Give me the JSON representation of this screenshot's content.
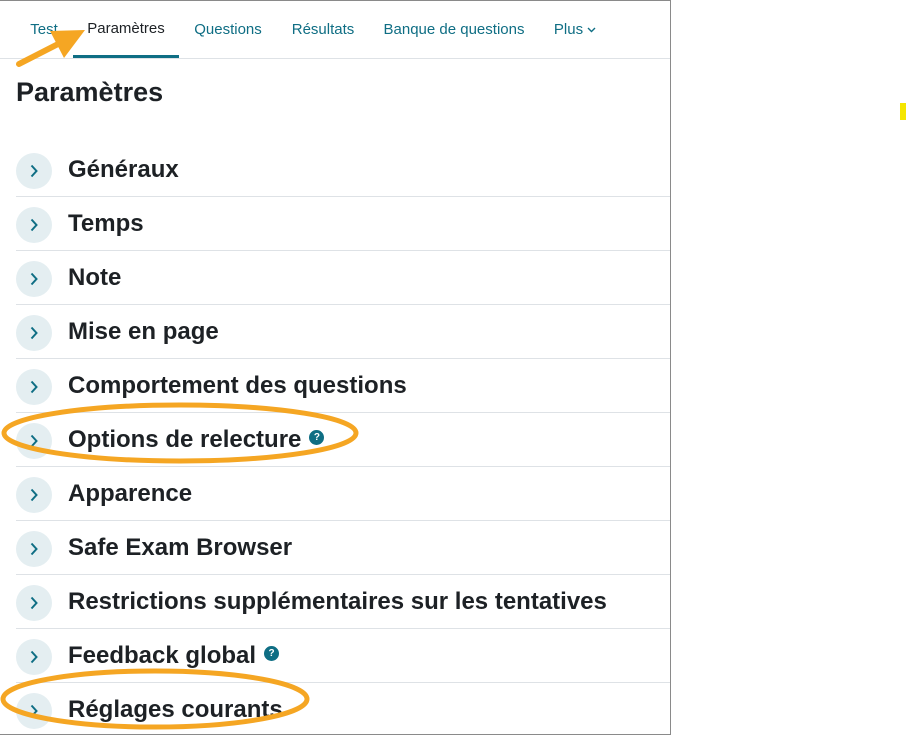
{
  "tabs": [
    {
      "label": "Test",
      "active": false
    },
    {
      "label": "Paramètres",
      "active": true
    },
    {
      "label": "Questions",
      "active": false
    },
    {
      "label": "Résultats",
      "active": false
    },
    {
      "label": "Banque de questions",
      "active": false
    },
    {
      "label": "Plus",
      "active": false,
      "has_dropdown": true
    }
  ],
  "page": {
    "title": "Paramètres"
  },
  "sections": [
    {
      "label": "Généraux",
      "help": false
    },
    {
      "label": "Temps",
      "help": false
    },
    {
      "label": "Note",
      "help": false
    },
    {
      "label": "Mise en page",
      "help": false
    },
    {
      "label": "Comportement des questions",
      "help": false
    },
    {
      "label": "Options de relecture",
      "help": true
    },
    {
      "label": "Apparence",
      "help": false
    },
    {
      "label": "Safe Exam Browser",
      "help": false
    },
    {
      "label": "Restrictions supplémentaires sur les tentatives",
      "help": false
    },
    {
      "label": "Feedback global",
      "help": true
    },
    {
      "label": "Réglages courants",
      "help": false
    }
  ],
  "help_symbol": "?",
  "colors": {
    "accent": "#0f6e84",
    "text": "#1d2125",
    "toggle_bg": "#e4eef1",
    "annotation": "#f5a623",
    "marker": "#f5e600"
  },
  "icons": {
    "section_toggle": "chevron-right-icon",
    "tab_dropdown": "chevron-down-icon",
    "help": "help-icon"
  }
}
